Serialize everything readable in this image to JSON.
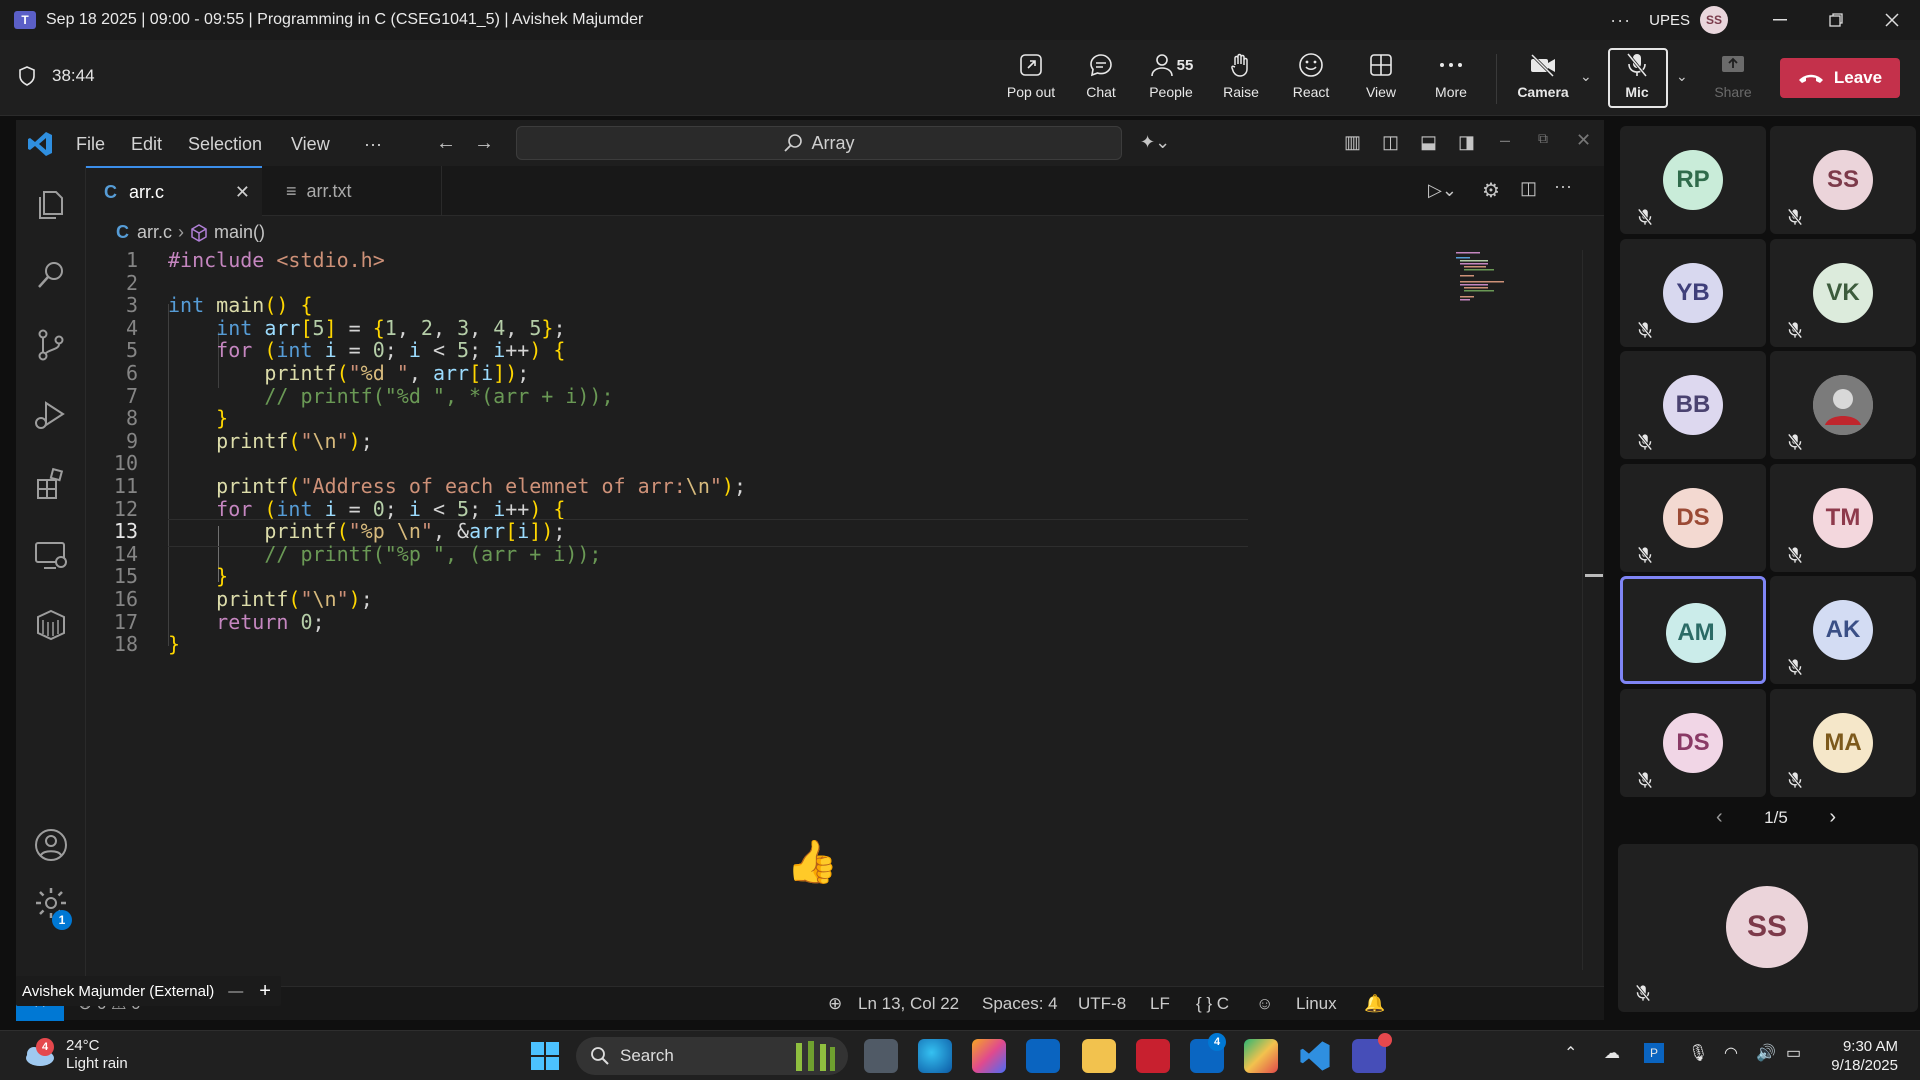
{
  "titlebar": {
    "title": "Sep 18 2025 | 09:00 - 09:55 | Programming in C (CSEG1041_5) | Avishek Majumder",
    "more": "···",
    "org": "UPES",
    "avatar": "SS"
  },
  "meeting": {
    "timer": "38:44",
    "buttons": {
      "pop_out": "Pop out",
      "chat": "Chat",
      "people": "People",
      "people_count": "55",
      "raise": "Raise",
      "react": "React",
      "view": "View",
      "more": "More",
      "camera": "Camera",
      "mic": "Mic",
      "share": "Share",
      "leave": "Leave"
    }
  },
  "vscode": {
    "menu": [
      "File",
      "Edit",
      "Selection",
      "View",
      "···"
    ],
    "search": "Array",
    "tabs": [
      {
        "label": "arr.c",
        "icon": "C",
        "active": true
      },
      {
        "label": "arr.txt",
        "icon": "≡",
        "active": false
      }
    ],
    "breadcrumb": {
      "file": "arr.c",
      "symbol": "main()"
    },
    "code_lines": [
      "#include <stdio.h>",
      "",
      "int main() {",
      "    int arr[5] = {1, 2, 3, 4, 5};",
      "    for (int i = 0; i < 5; i++) {",
      "        printf(\"%d \", arr[i]);",
      "        // printf(\"%d \", *(arr + i));",
      "    }",
      "    printf(\"\\n\");",
      "",
      "    printf(\"Address of each elemnet of arr:\\n\");",
      "    for (int i = 0; i < 5; i++) {",
      "        printf(\"%p \\n\", &arr[i]);",
      "        // printf(\"%p \", (arr + i));",
      "    }",
      "    printf(\"\\n\");",
      "    return 0;",
      "}"
    ],
    "line_numbers": [
      "1",
      "2",
      "3",
      "4",
      "5",
      "6",
      "7",
      "8",
      "9",
      "10",
      "11",
      "12",
      "13",
      "14",
      "15",
      "16",
      "17",
      "18"
    ],
    "current_line": 13,
    "status": {
      "position": "Ln 13, Col 22",
      "spaces": "Spaces: 4",
      "encoding": "UTF-8",
      "eol": "LF",
      "language": "{ } C",
      "platform": "Linux",
      "errors": "0",
      "warnings": "0"
    },
    "settings_badge": "1",
    "reaction": "👍"
  },
  "presenter_chip": "Avishek Majumder (External)",
  "participants": [
    {
      "initials": "RP",
      "bg": "#c9ecd9",
      "fg": "#2f6b4b",
      "muted": true
    },
    {
      "initials": "SS",
      "bg": "#ebd4da",
      "fg": "#7c3a4a",
      "muted": true
    },
    {
      "initials": "YB",
      "bg": "#d8d8ef",
      "fg": "#3f3f7a",
      "muted": true
    },
    {
      "initials": "VK",
      "bg": "#dcebdc",
      "fg": "#3d5c3d",
      "muted": true
    },
    {
      "initials": "BB",
      "bg": "#ddd8ef",
      "fg": "#4a4270",
      "muted": true
    },
    {
      "initials": "",
      "bg": "#8a8a8a",
      "fg": "#ffffff",
      "muted": true,
      "photo": true
    },
    {
      "initials": "DS",
      "bg": "#f3d9d1",
      "fg": "#9b4a35",
      "muted": true
    },
    {
      "initials": "TM",
      "bg": "#f3d7dd",
      "fg": "#8e3a4c",
      "muted": true
    },
    {
      "initials": "AM",
      "bg": "#cbecea",
      "fg": "#2b6b66",
      "muted": false,
      "speaking": true
    },
    {
      "initials": "AK",
      "bg": "#d3dcf3",
      "fg": "#3a4f86",
      "muted": true
    },
    {
      "initials": "DS",
      "bg": "#f1d6e6",
      "fg": "#8a3a66",
      "muted": true
    },
    {
      "initials": "MA",
      "bg": "#f5e7c9",
      "fg": "#7d5a1c",
      "muted": true
    }
  ],
  "pager": "1/5",
  "self_tile": {
    "initials": "SS"
  },
  "taskbar": {
    "weather_badge": "4",
    "temp": "24°C",
    "condition": "Light rain",
    "search": "Search",
    "linkedin_badge": "4",
    "time": "9:30 AM",
    "date": "9/18/2025"
  }
}
